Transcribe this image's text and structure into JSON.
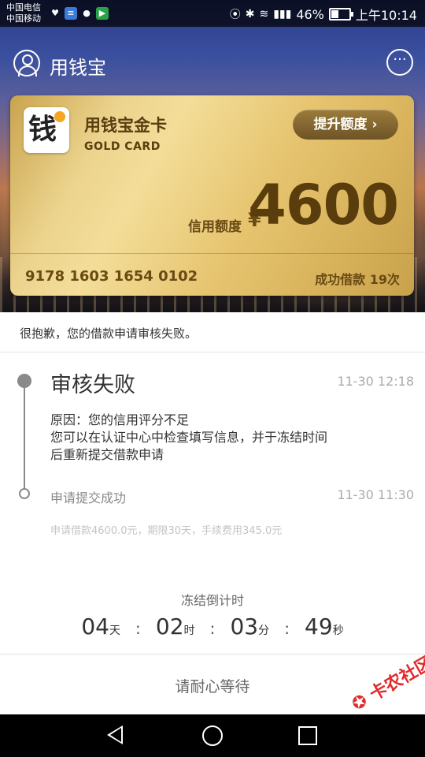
{
  "status_bar": {
    "carrier1": "中国电信",
    "carrier2": "中国移动",
    "battery": "46%",
    "battery_level": 0.46,
    "time": "上午10:14"
  },
  "app": {
    "title": "用钱宝"
  },
  "card": {
    "name": "用钱宝金卡",
    "subtitle": "GOLD CARD",
    "raise_button": "提升额度",
    "credit_label": "信用额度",
    "currency": "¥",
    "credit_amount": "4600",
    "card_number": "9178 1603 1654 0102",
    "loans": "成功借款 19次"
  },
  "notice": "很抱歉，您的借款申请审核失败。",
  "timeline": {
    "fail_title": "审核失败",
    "fail_time": "11-30 12:18",
    "reason_line1": "原因：您的信用评分不足",
    "reason_line2": "您可以在认证中心中检查填写信息，并于冻结时间后重新提交借款申请",
    "submit_title": "申请提交成功",
    "submit_time": "11-30 11:30",
    "submit_detail": "申请借款4600.0元，期限30天，手续费用345.0元"
  },
  "countdown": {
    "title": "冻结倒计时",
    "days": "04",
    "days_unit": "天",
    "hours": "02",
    "hours_unit": "时",
    "minutes": "03",
    "minutes_unit": "分",
    "seconds": "49",
    "seconds_unit": "秒"
  },
  "wait_button": "请耐心等待",
  "colors": {
    "gold": "#e6c46f",
    "gold_text": "#5a3d0c"
  }
}
